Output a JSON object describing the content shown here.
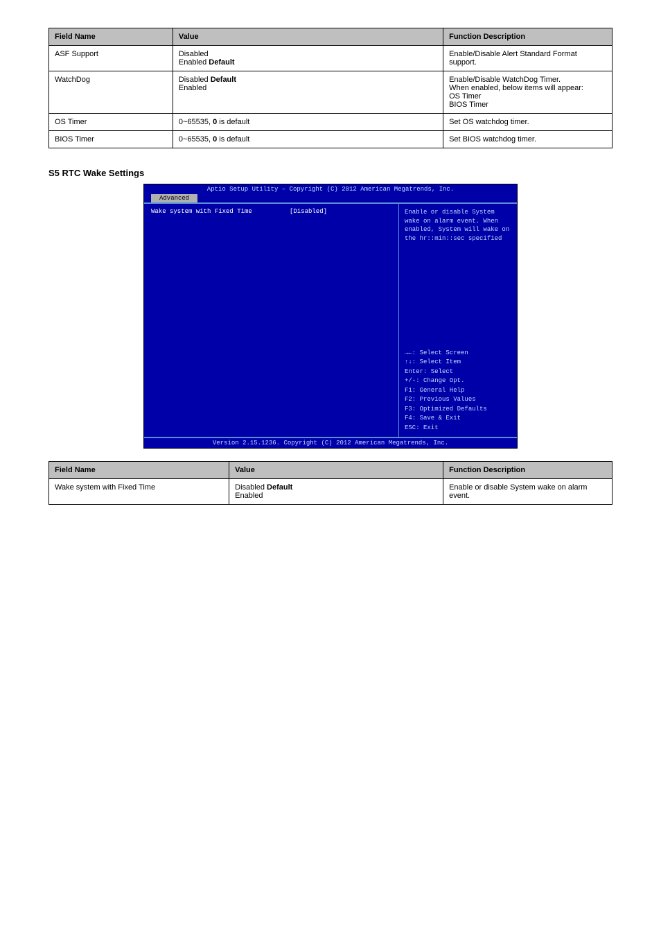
{
  "table1": {
    "headers": [
      "Field Name",
      "Value",
      "Function Description"
    ],
    "rows": [
      {
        "name": "ASF Support",
        "value": "Disabled<br>Enabled <b>Default</b>",
        "desc": "Enable/Disable Alert Standard Format support."
      },
      {
        "name": "WatchDog",
        "value": "Disabled <b>Default</b><br>Enabled",
        "desc": "Enable/Disable WatchDog Timer.<br>When enabled, below items will appear:<br>OS Timer<br>BIOS Timer"
      },
      {
        "name": "OS Timer",
        "value": "0~65535, <b>0</b> is default",
        "desc": "Set OS watchdog timer."
      },
      {
        "name": "BIOS Timer",
        "value": "0~65535, <b>0</b> is default",
        "desc": "Set BIOS watchdog timer."
      }
    ]
  },
  "section_title": "S5 RTC Wake Settings",
  "bios": {
    "header": "Aptio Setup Utility – Copyright (C) 2012 American Megatrends, Inc.",
    "tab": "Advanced",
    "item_label": "Wake system with Fixed Time",
    "item_value": "[Disabled]",
    "help_top": "Enable or disable System wake on alarm event. When enabled, System will wake on the hr::min::sec specified",
    "help_lines": [
      "→←: Select Screen",
      "↑↓: Select Item",
      "Enter: Select",
      "+/-: Change Opt.",
      "F1: General Help",
      "F2: Previous Values",
      "F3: Optimized Defaults",
      "F4: Save & Exit",
      "ESC: Exit"
    ],
    "footer": "Version 2.15.1236. Copyright (C) 2012 American Megatrends, Inc."
  },
  "table2": {
    "headers": [
      "Field Name",
      "Value",
      "Function Description"
    ],
    "rows": [
      {
        "name": "Wake system with Fixed Time",
        "value": "Disabled <b>Default</b><br>Enabled",
        "desc": "Enable or disable System wake on alarm event."
      }
    ]
  }
}
